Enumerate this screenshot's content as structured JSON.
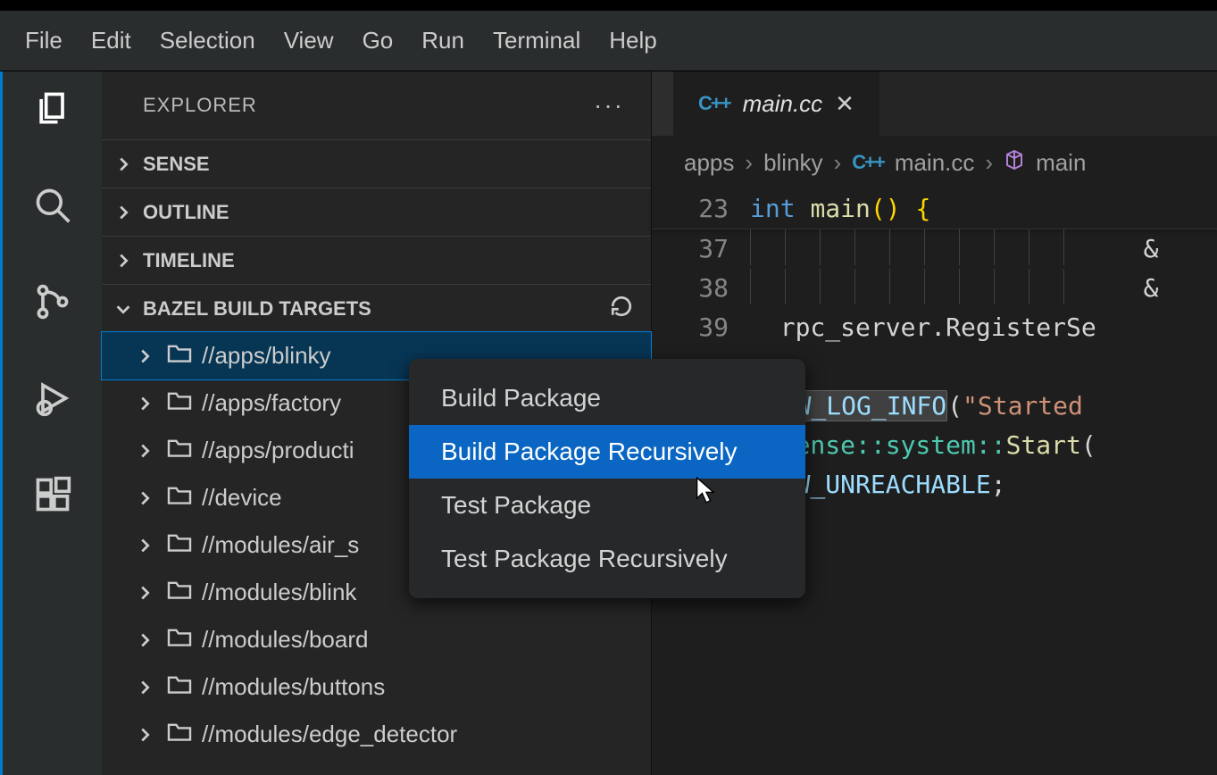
{
  "menubar": [
    "File",
    "Edit",
    "Selection",
    "View",
    "Go",
    "Run",
    "Terminal",
    "Help"
  ],
  "sidebar": {
    "title": "EXPLORER",
    "sections": {
      "sense": "SENSE",
      "outline": "OUTLINE",
      "timeline": "TIMELINE",
      "bazel": "BAZEL BUILD TARGETS"
    },
    "bazel_items": [
      "//apps/blinky",
      "//apps/factory",
      "//apps/producti",
      "//device",
      "//modules/air_s",
      "//modules/blink",
      "//modules/board",
      "//modules/buttons",
      "//modules/edge_detector"
    ]
  },
  "tab": {
    "filename": "main.cc"
  },
  "breadcrumbs": {
    "a": "apps",
    "b": "blinky",
    "c": "main.cc",
    "d": "main"
  },
  "code": {
    "sticky_line_no": "23",
    "sticky_kw": "int",
    "sticky_fn": "main",
    "sticky_tail": "() {",
    "l37": "37",
    "l38": "38",
    "l39": "39",
    "l39_text": "rpc_server.RegisterSe",
    "l41_macro": "PW_LOG_INFO",
    "l41_str": "\"Started",
    "l42_ns": "sense::system::",
    "l42_fn": "Start",
    "l43": "PW_UNREACHABLE",
    "amp": "&"
  },
  "context_menu": [
    "Build Package",
    "Build Package Recursively",
    "Test Package",
    "Test Package Recursively"
  ]
}
